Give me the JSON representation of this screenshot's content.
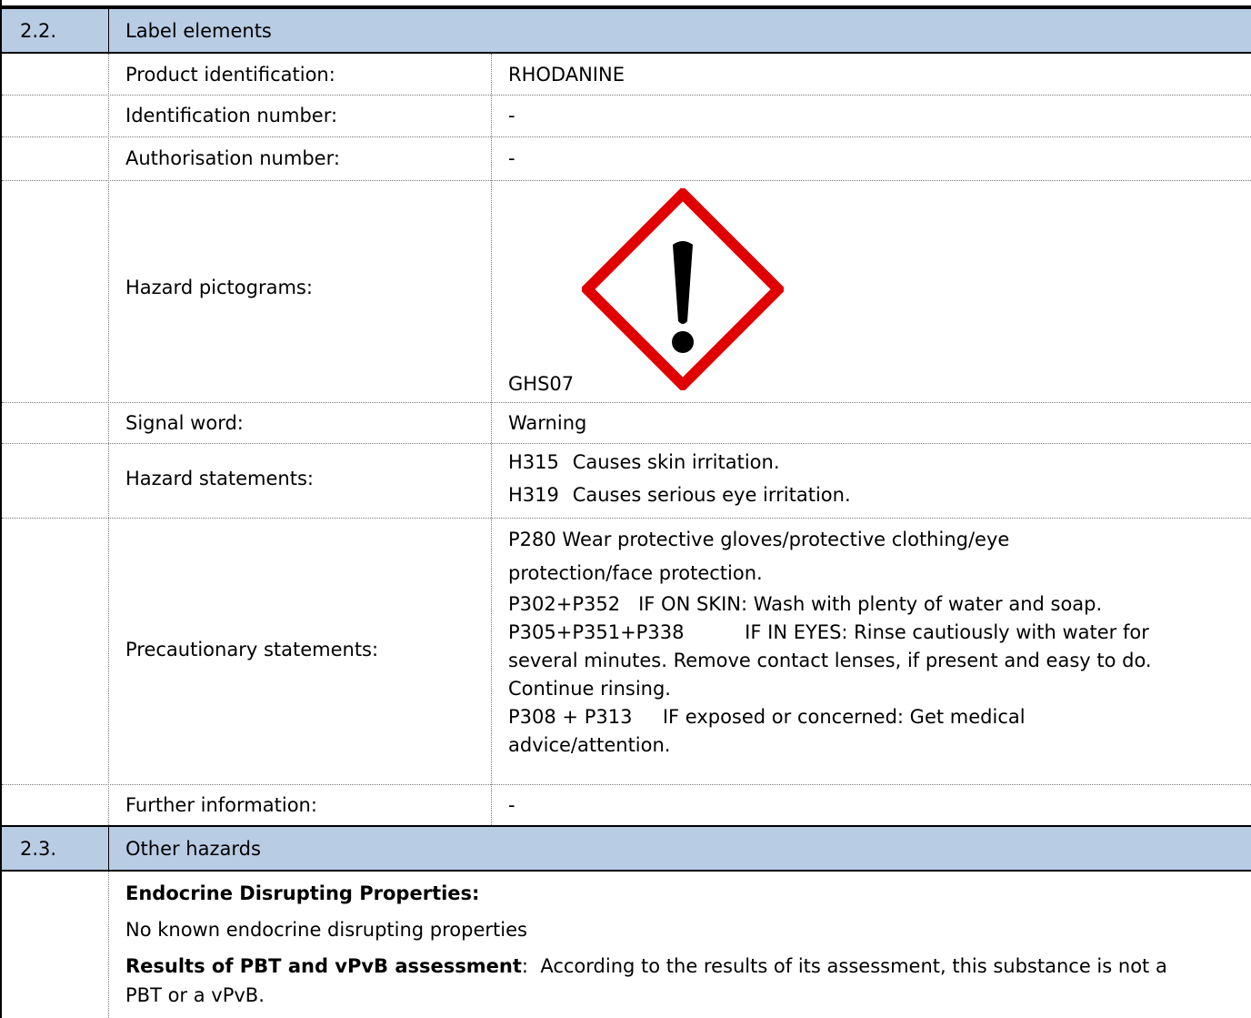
{
  "sections": [
    {
      "number": "2.2.",
      "title": "Label elements"
    },
    {
      "number": "2.3.",
      "title": "Other hazards"
    }
  ],
  "rows": {
    "product_identification": {
      "label": "Product identification:",
      "value": "RHODANINE"
    },
    "identification_number": {
      "label": "Identification number:",
      "value": "-"
    },
    "authorisation_number": {
      "label": "Authorisation number:",
      "value": "-"
    },
    "hazard_pictograms": {
      "label": "Hazard pictograms:",
      "code": "GHS07",
      "icon": "exclamation-mark-pictogram-icon",
      "border_color": "#e00000"
    },
    "signal_word": {
      "label": "Signal word:",
      "value": "Warning"
    },
    "hazard_statements": {
      "label": "Hazard statements:",
      "items": [
        {
          "code": "H315",
          "text": "Causes skin irritation."
        },
        {
          "code": "H319",
          "text": "Causes serious eye irritation."
        }
      ]
    },
    "precautionary_statements": {
      "label": "Precautionary statements:",
      "lines": [
        "P280 Wear protective gloves/protective clothing/eye",
        "protection/face protection.",
        "P302+P352   IF ON SKIN: Wash with plenty of water and soap.",
        "P305+P351+P338          IF IN EYES: Rinse cautiously with water for",
        "several minutes. Remove contact lenses, if present and easy to do.",
        "Continue rinsing.",
        "P308 + P313     IF exposed or concerned: Get medical",
        "advice/attention."
      ]
    },
    "further_information": {
      "label": "Further information:",
      "value": "-"
    }
  },
  "other_hazards": {
    "endocrine_heading": "Endocrine Disrupting Properties:",
    "endocrine_text": "No known endocrine disrupting properties",
    "pbt_heading": "Results of PBT and vPvB assessment",
    "pbt_text_line1": ":  According to the results of its assessment, this substance is not a",
    "pbt_text_line2": "PBT or a vPvB."
  },
  "colors": {
    "section_header_bg": "#b8cce4",
    "pictogram_red": "#e00000"
  }
}
